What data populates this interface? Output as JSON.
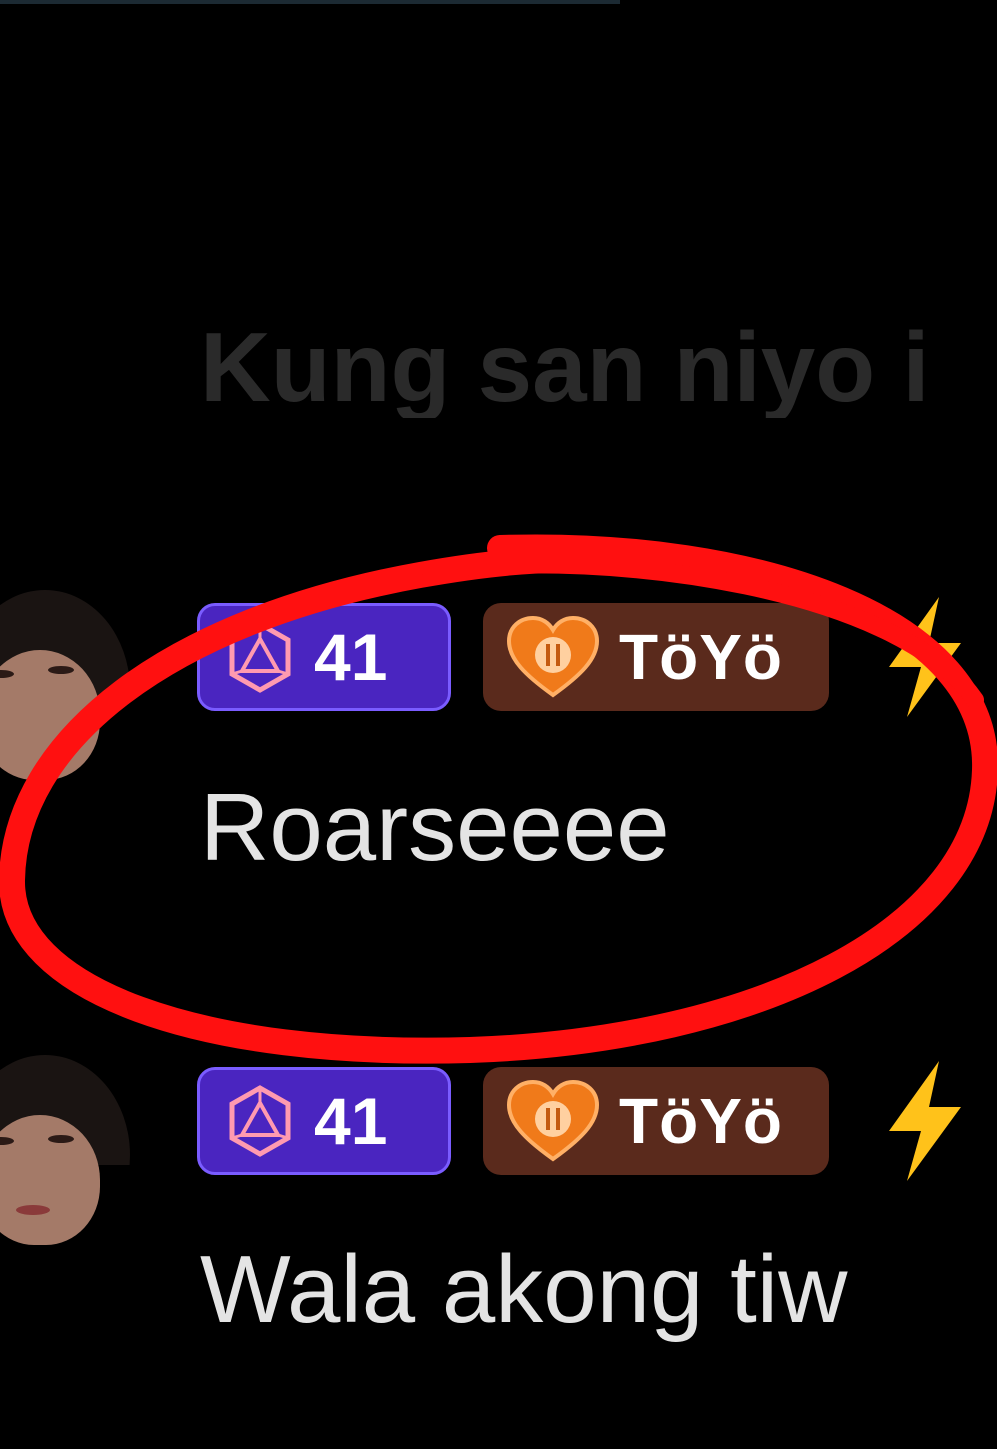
{
  "faded_comment": {
    "text": "Kung san niyo i"
  },
  "comments": [
    {
      "level": "41",
      "fan_club": "TöYö",
      "text": "Roarseeee",
      "highlighted": true
    },
    {
      "level": "41",
      "fan_club": "TöYö",
      "text": "Wala akong tiw",
      "highlighted": false
    }
  ],
  "icons": {
    "level": "level-gem-icon",
    "fan": "heart-badge-icon",
    "extra": "lightning-bolt-icon"
  },
  "colors": {
    "background": "#000000",
    "level_badge": "#4a25c0",
    "fan_badge": "#5a2a1c",
    "annotation": "#ff1010"
  }
}
